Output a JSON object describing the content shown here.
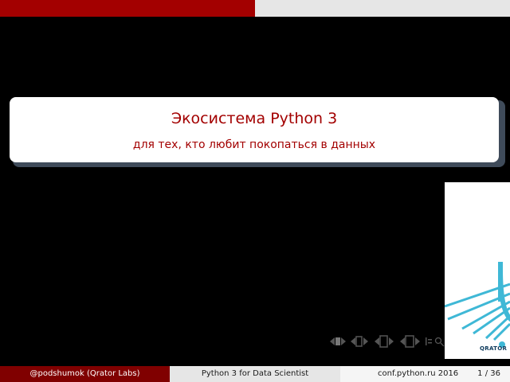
{
  "slide": {
    "title": "Экосистема Python 3",
    "subtitle": "для тех, кто любит покопаться в данных"
  },
  "progress": {
    "fraction": 0.5
  },
  "logo": {
    "name": "QRATOR"
  },
  "footer": {
    "author": "@podshumok  (Qrator Labs)",
    "talk_title": "Python 3 for Data Scientist",
    "conference": "conf.python.ru 2016",
    "page": "1 / 36"
  },
  "colors": {
    "accent": "#a30000",
    "footer_dark": "#800000",
    "logo_blue": "#3fb8d6"
  },
  "nav_icons": [
    "first-frame-icon",
    "prev-frame-icon",
    "next-frame-icon",
    "prev-section-icon",
    "next-section-icon",
    "prev-subsection-icon",
    "next-subsection-icon",
    "align-icon",
    "search-icon"
  ]
}
